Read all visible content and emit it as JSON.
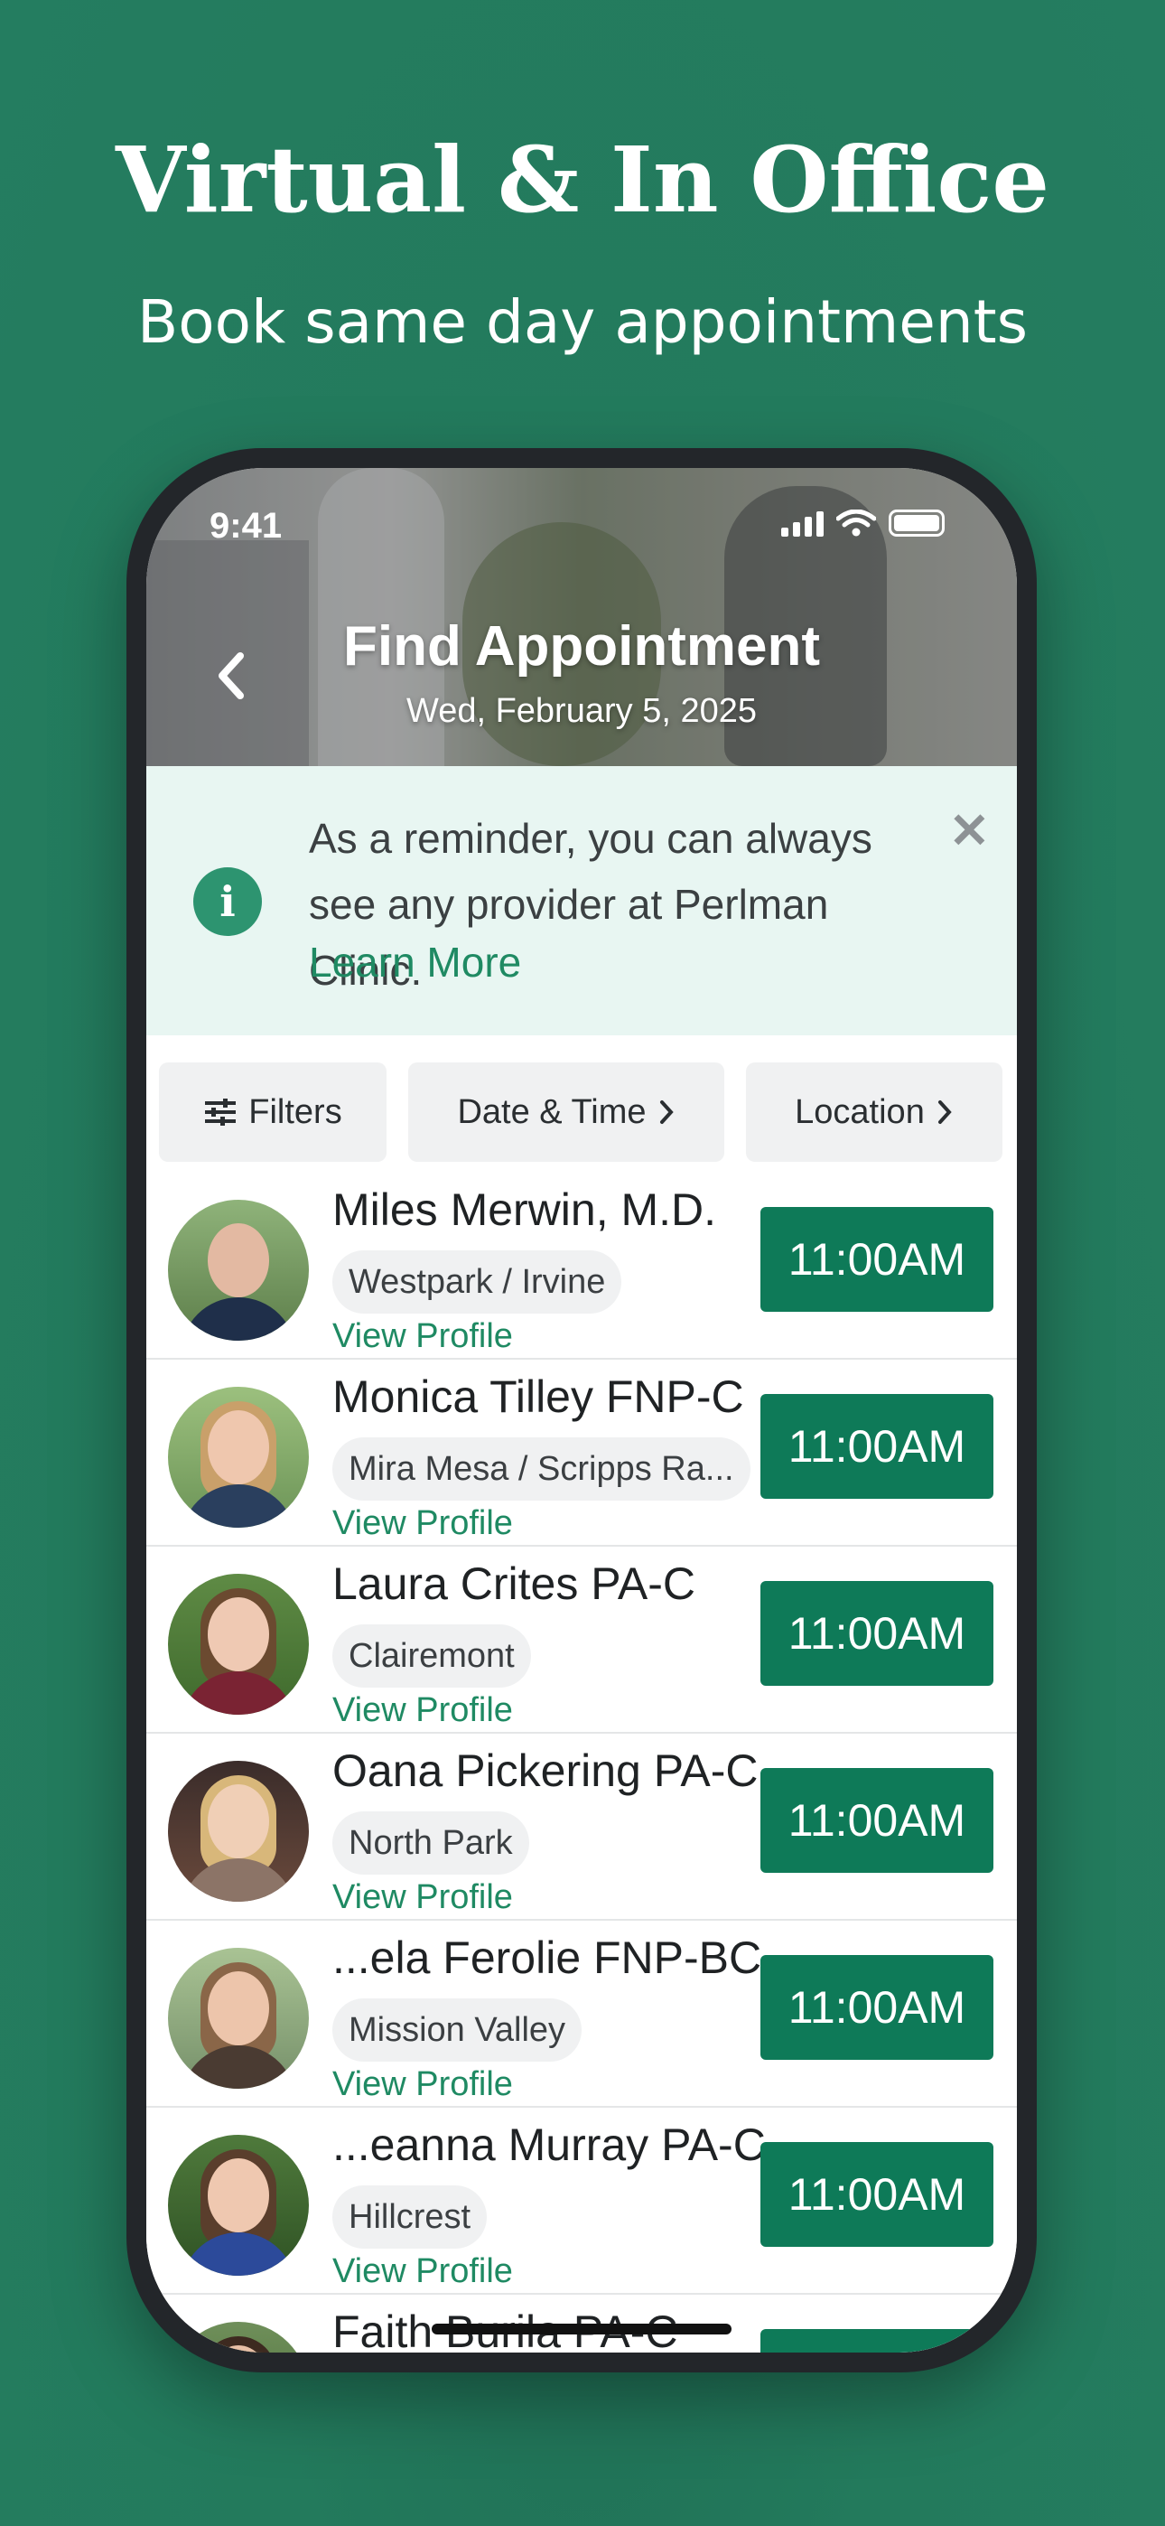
{
  "promo": {
    "headline": "Virtual & In Office",
    "subheadline": "Book same day appointments"
  },
  "status_bar": {
    "time": "9:41"
  },
  "header": {
    "title": "Find Appointment",
    "date": "Wed, February 5, 2025"
  },
  "banner": {
    "text": "As a reminder, you can always see any provider at Perlman Clinic.",
    "link": "Learn More"
  },
  "filters": {
    "filters_label": "Filters",
    "date_time_label": "Date & Time",
    "location_label": "Location"
  },
  "providers": [
    {
      "name": "Miles Merwin, M.D.",
      "location": "Westpark / Irvine",
      "view_profile": "View Profile",
      "time": "11:00AM"
    },
    {
      "name": "Monica Tilley FNP-C",
      "location": "Mira Mesa / Scripps Ra...",
      "view_profile": "View Profile",
      "time": "11:00AM"
    },
    {
      "name": "Laura Crites PA-C",
      "location": "Clairemont",
      "view_profile": "View Profile",
      "time": "11:00AM"
    },
    {
      "name": "Oana Pickering PA-C",
      "location": "North Park",
      "view_profile": "View Profile",
      "time": "11:00AM"
    },
    {
      "name": "...ela Ferolie FNP-BC",
      "location": "Mission Valley",
      "view_profile": "View Profile",
      "time": "11:00AM"
    },
    {
      "name": "...eanna Murray PA-C",
      "location": "Hillcrest",
      "view_profile": "View Profile",
      "time": "11:00AM"
    },
    {
      "name": "Faith Burila PA-C",
      "location": "",
      "view_profile": "",
      "time": ""
    }
  ],
  "colors": {
    "background": "#247d60",
    "accent": "#0e7a58",
    "link": "#1f8a63",
    "banner_bg": "#e8f6f2"
  }
}
